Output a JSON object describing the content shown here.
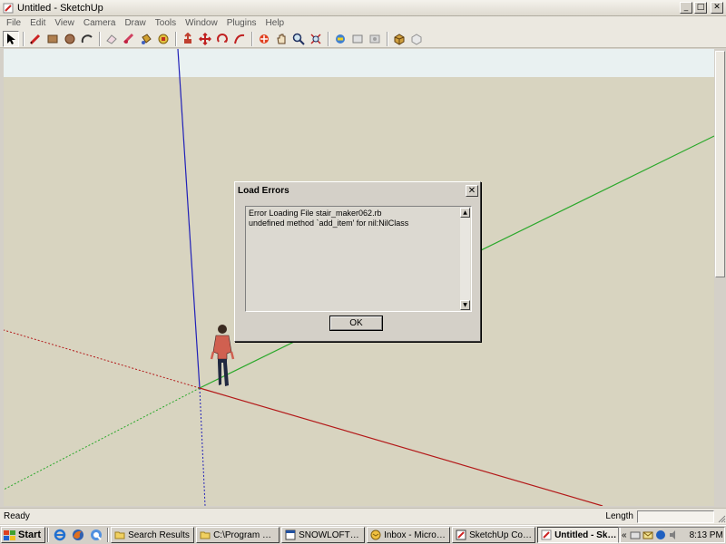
{
  "window": {
    "title": "Untitled - SketchUp",
    "minimize": "_",
    "maximize": "□",
    "close": "✕"
  },
  "menu": [
    "File",
    "Edit",
    "View",
    "Camera",
    "Draw",
    "Tools",
    "Window",
    "Plugins",
    "Help"
  ],
  "toolbar": {
    "tools": [
      {
        "name": "select-tool-icon",
        "selected": true
      },
      {
        "name": "pencil-tool-icon"
      },
      {
        "name": "rectangle-tool-icon"
      },
      {
        "name": "circle-tool-icon"
      },
      {
        "name": "arc-tool-icon"
      },
      {
        "name": "eraser-tool-icon"
      },
      {
        "name": "tape-measure-tool-icon"
      },
      {
        "name": "paint-bucket-tool-icon"
      },
      {
        "name": "orbit-tool-icon"
      },
      {
        "name": "push-pull-tool-icon"
      },
      {
        "name": "move-tool-icon"
      },
      {
        "name": "rotate-tool-icon"
      },
      {
        "name": "follow-me-tool-icon"
      },
      {
        "name": "offset-tool-icon"
      },
      {
        "name": "pan-tool-icon"
      },
      {
        "name": "zoom-tool-icon"
      },
      {
        "name": "zoom-extents-tool-icon"
      },
      {
        "name": "get-models-icon"
      },
      {
        "name": "share-model-icon"
      },
      {
        "name": "share-component-icon"
      },
      {
        "name": "components-icon"
      },
      {
        "name": "materials-icon"
      }
    ]
  },
  "colors": {
    "sky": "#e9f1f1",
    "ground": "#d8d4c0",
    "axis_red": "#b31919",
    "axis_green": "#2aa82a",
    "axis_blue": "#2020b8"
  },
  "dialog": {
    "title": "Load Errors",
    "close": "✕",
    "lines": [
      "Error Loading File stair_maker062.rb",
      "undefined method `add_item' for nil:NilClass"
    ],
    "ok": "OK"
  },
  "status": {
    "text": "Ready",
    "length_label": "Length"
  },
  "taskbar": {
    "start": "Start",
    "buttons": [
      {
        "label": "Search Results",
        "icon": "folder-icon",
        "active": false
      },
      {
        "label": "C:\\Program File...",
        "icon": "folder-icon",
        "active": false
      },
      {
        "label": "SNOWLOFT1 co...",
        "icon": "window-icon",
        "active": false
      },
      {
        "label": "Inbox - Microso...",
        "icon": "mail-icon",
        "active": false
      },
      {
        "label": "SketchUp Comm...",
        "icon": "browser-icon",
        "active": false
      },
      {
        "label": "Untitled - Ske...",
        "icon": "sketchup-icon",
        "active": true
      }
    ],
    "tray_expand": "«",
    "clock": "8:13 PM"
  }
}
